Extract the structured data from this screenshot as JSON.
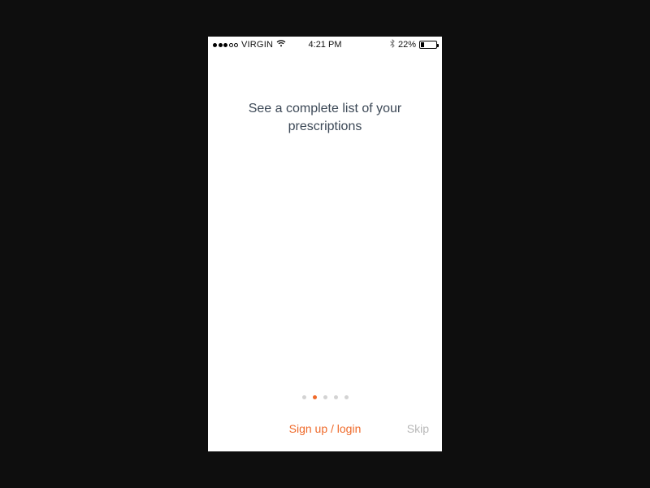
{
  "status_bar": {
    "carrier": "VIRGIN",
    "time": "4:21 PM",
    "battery_pct": "22%"
  },
  "onboarding": {
    "headline": "See a complete list of your prescriptions",
    "page_index": 1,
    "page_count": 5
  },
  "actions": {
    "signup_login": "Sign up / login",
    "skip": "Skip"
  },
  "colors": {
    "accent": "#ef6a2a",
    "headline": "#3c4856",
    "muted": "#b8b8b8"
  }
}
